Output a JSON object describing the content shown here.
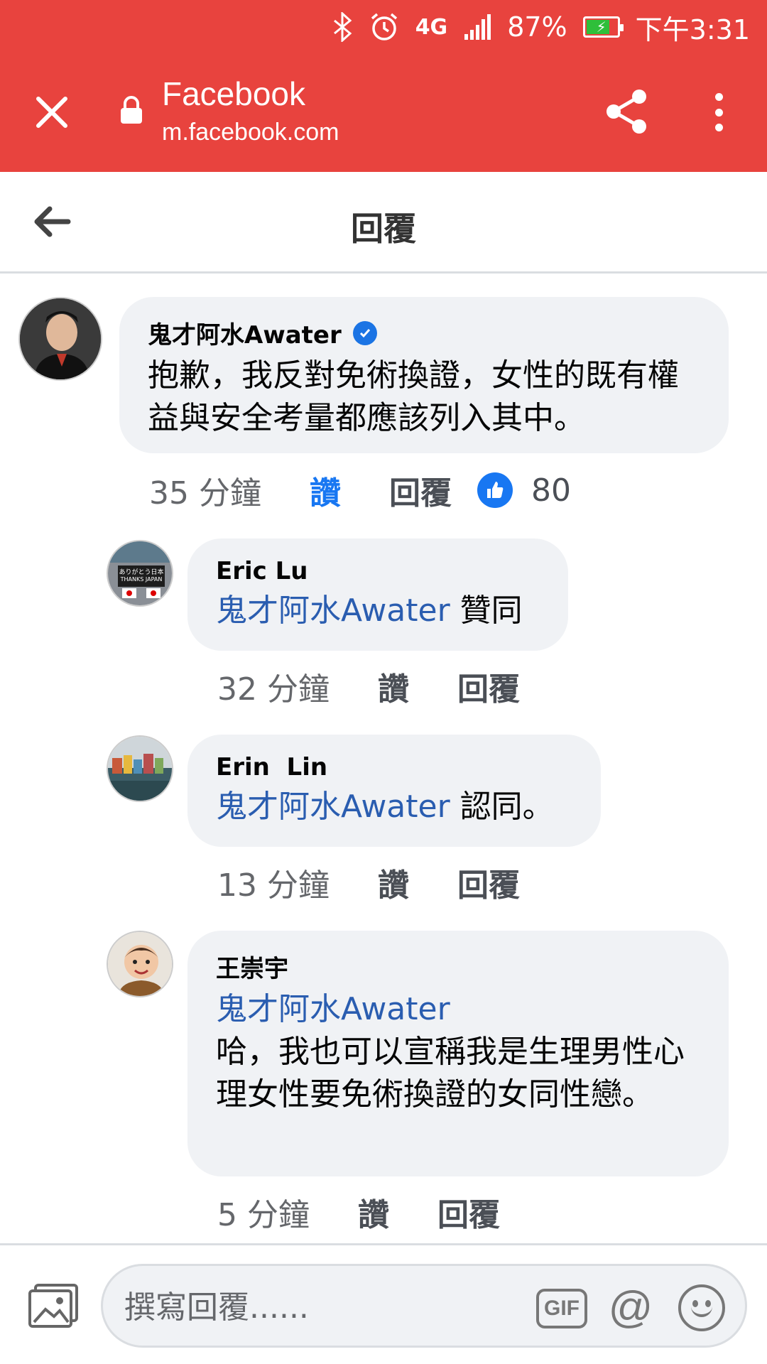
{
  "status_bar": {
    "network": "4G",
    "battery_percent": "87%",
    "time": "下午3:31"
  },
  "browser": {
    "title": "Facebook",
    "url": "m.facebook.com"
  },
  "header": {
    "title": "回覆"
  },
  "comments": [
    {
      "author": "鬼才阿水Awater",
      "verified": true,
      "mention": "",
      "text": "抱歉，我反對免術換證，女性的既有權益與安全考量都應該列入其中。",
      "time": "35 分鐘",
      "like_label": "讚",
      "reply_label": "回覆",
      "reaction_count": "80"
    },
    {
      "author": "Eric Lu",
      "mention": "鬼才阿水Awater",
      "text": " 贊同",
      "time": "32 分鐘",
      "like_label": "讚",
      "reply_label": "回覆"
    },
    {
      "author": "Erin  Lin",
      "mention": "鬼才阿水Awater",
      "text": " 認同。",
      "time": "13 分鐘",
      "like_label": "讚",
      "reply_label": "回覆"
    },
    {
      "author": "王崇宇",
      "mention": "鬼才阿水Awater",
      "text": "哈，我也可以宣稱我是生理男性心理女性要免術換證的女同性戀。",
      "time": "5 分鐘",
      "like_label": "讚",
      "reply_label": "回覆"
    }
  ],
  "avatar_texts": {
    "eric": "ありがとう日本 THANKS JAPAN 感謝日本"
  },
  "composer": {
    "placeholder": "撰寫回覆......",
    "gif_label": "GIF",
    "at_label": "@"
  },
  "colors": {
    "browser_bar": "#e8433e",
    "link": "#2a5db0",
    "like_active": "#1877f2",
    "bubble": "#f0f2f5"
  }
}
